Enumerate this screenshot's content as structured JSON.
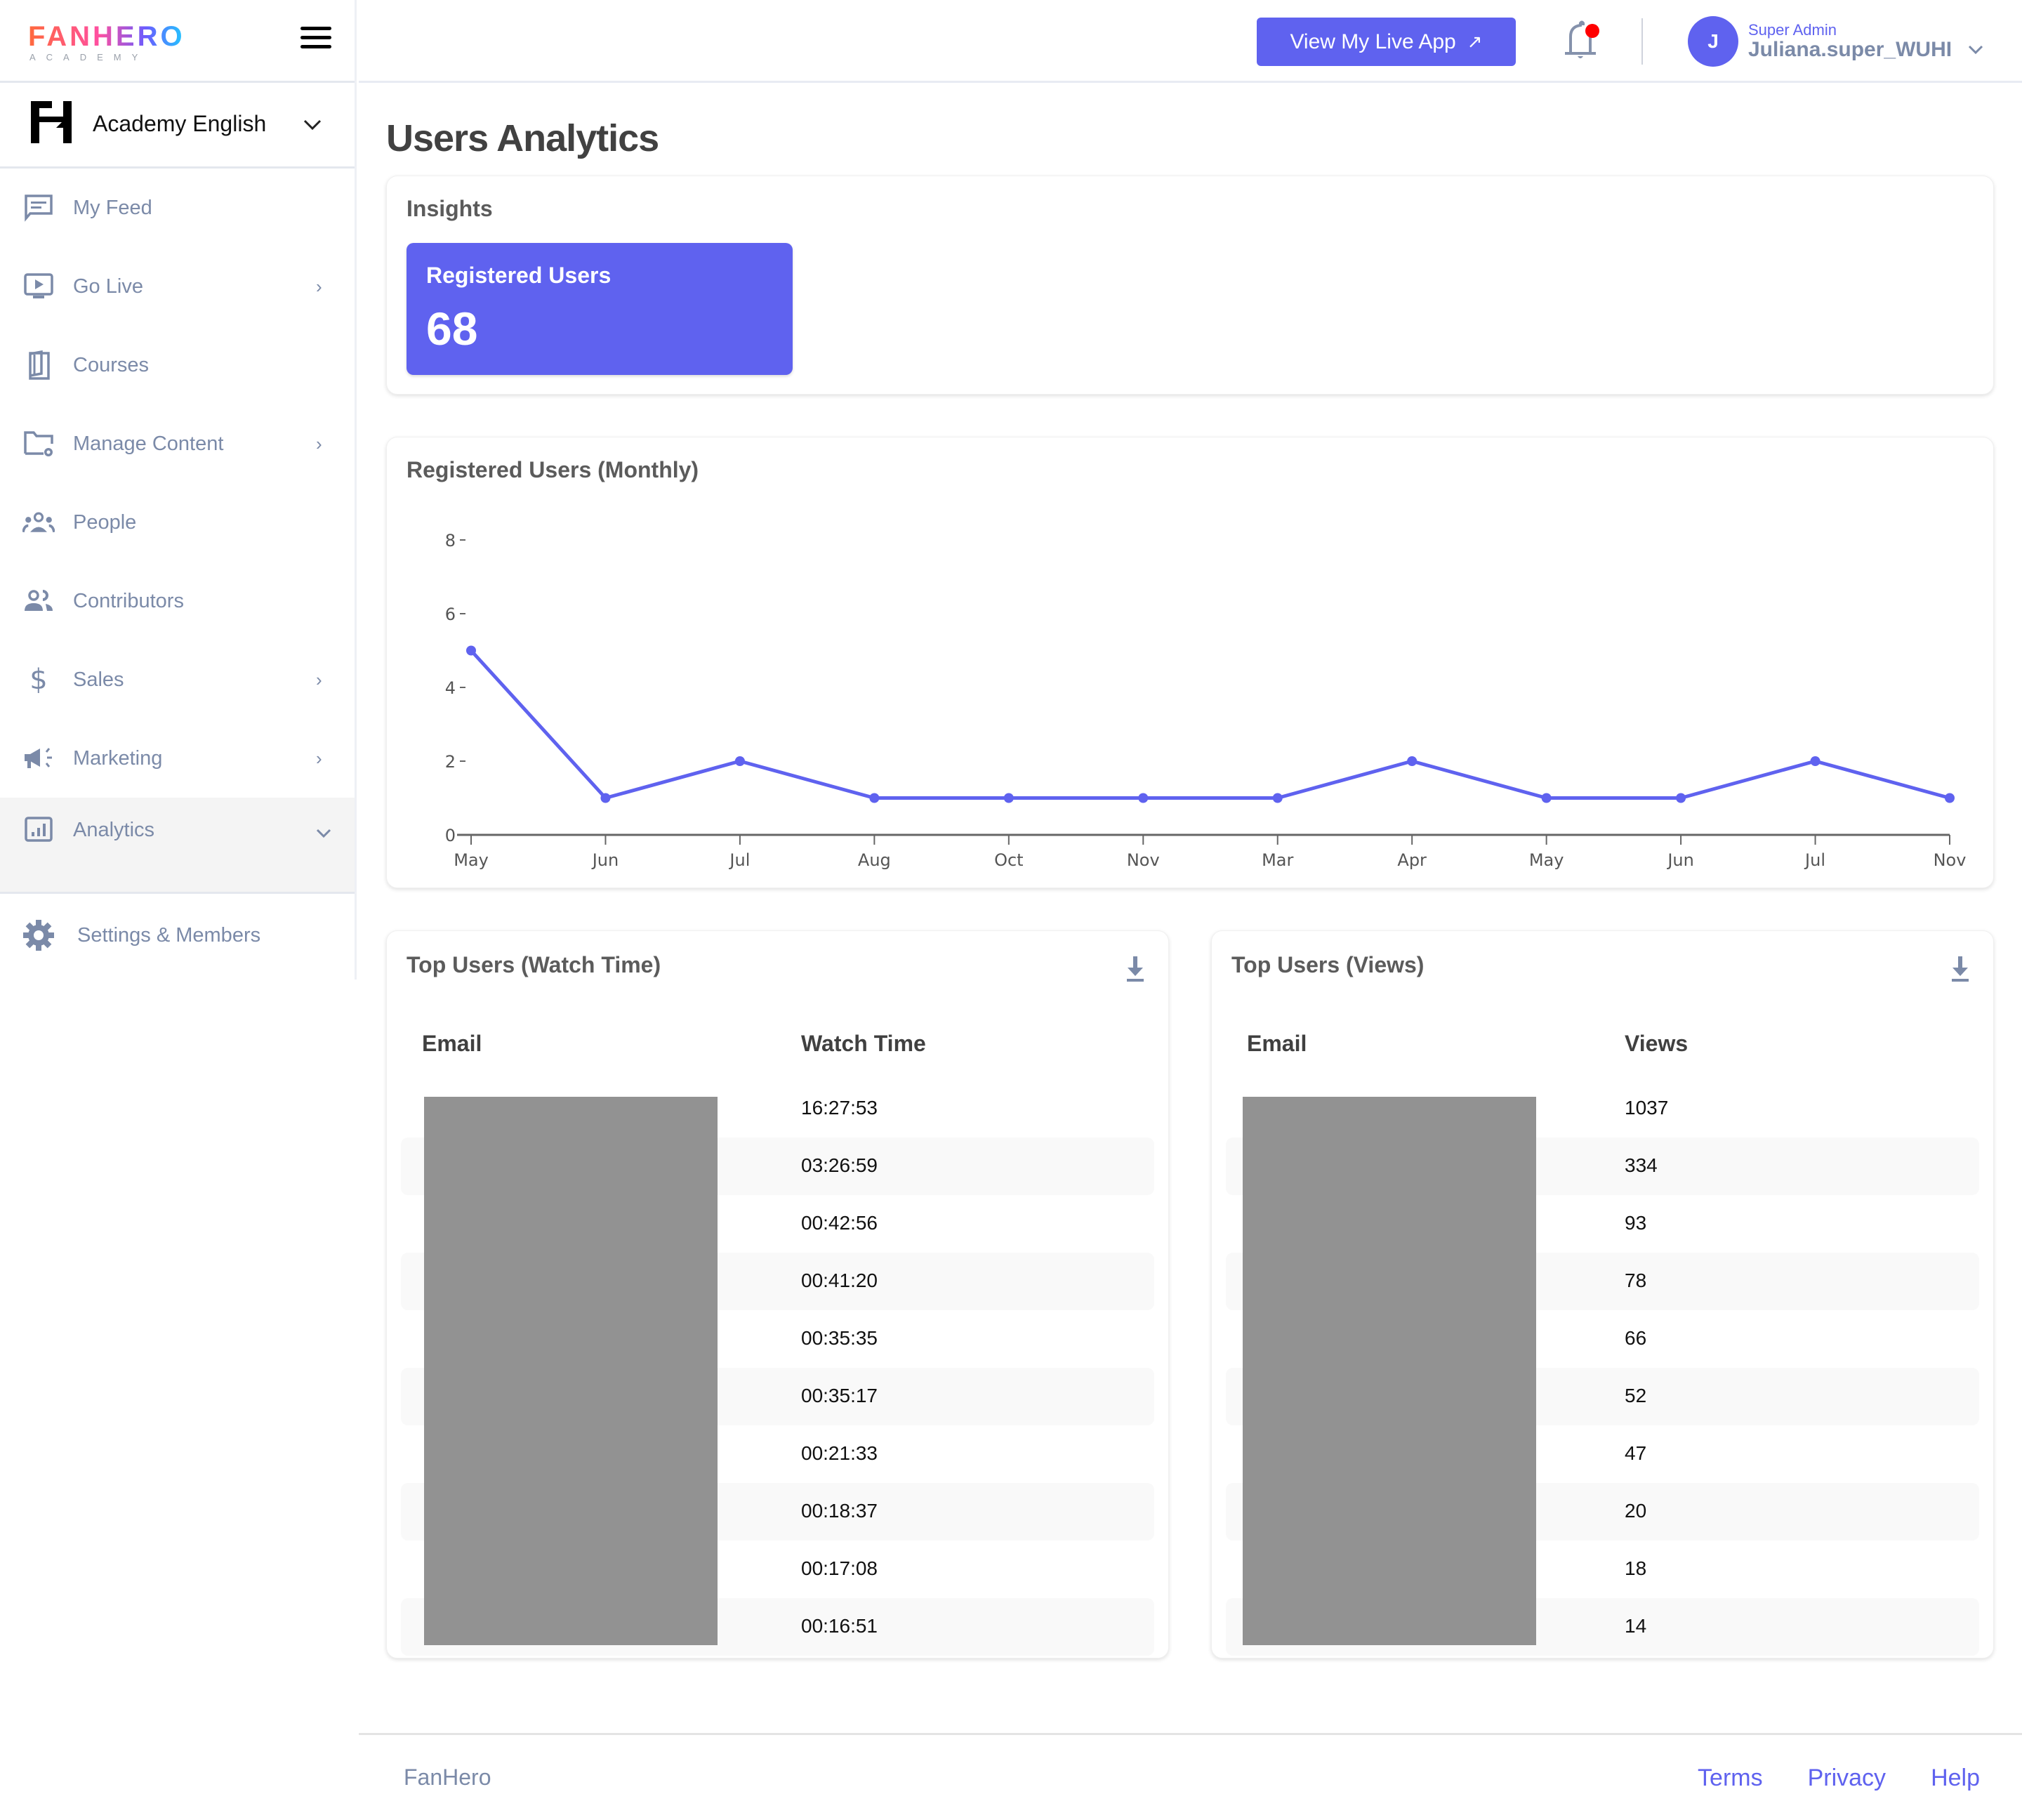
{
  "brand": {
    "logo_word": "FANHERO",
    "logo_sub": "ACADEMY",
    "org_name": "Academy English"
  },
  "sidebar": {
    "items": [
      {
        "label": "My Feed",
        "icon": "feed-icon",
        "has_arrow": false
      },
      {
        "label": "Go Live",
        "icon": "live-tv-icon",
        "has_arrow": true
      },
      {
        "label": "Courses",
        "icon": "book-icon",
        "has_arrow": false
      },
      {
        "label": "Manage Content",
        "icon": "folder-gear-icon",
        "has_arrow": true
      },
      {
        "label": "People",
        "icon": "people-icon",
        "has_arrow": false
      },
      {
        "label": "Contributors",
        "icon": "contributors-icon",
        "has_arrow": false
      },
      {
        "label": "Sales",
        "icon": "dollar-icon",
        "has_arrow": true
      },
      {
        "label": "Marketing",
        "icon": "megaphone-icon",
        "has_arrow": true
      },
      {
        "label": "Analytics",
        "icon": "analytics-icon",
        "expanded": true
      }
    ],
    "settings_label": "Settings & Members",
    "arrow_right": "›",
    "arrow_down": "⌄"
  },
  "header": {
    "live_button_label": "View My Live App",
    "live_button_icon": "↗",
    "notification_unread": true,
    "avatar_initial": "J",
    "user_role": "Super Admin",
    "user_name": "Juliana.super_WUHI",
    "user_chevron": "⌄"
  },
  "page": {
    "title": "Users Analytics",
    "insights_title": "Insights",
    "stat_label": "Registered Users",
    "stat_value": "68"
  },
  "colors": {
    "accent": "#5f62ef",
    "nav_text": "#7b8aa8",
    "notification_dot": "#ff0000",
    "redaction": "#929292"
  },
  "chart_data": {
    "type": "line",
    "title": "Registered Users (Monthly)",
    "xlabel": "",
    "ylabel": "",
    "categories": [
      "May",
      "Jun",
      "Jul",
      "Aug",
      "Oct",
      "Nov",
      "Mar",
      "Apr",
      "May",
      "Jun",
      "Jul",
      "Nov"
    ],
    "values": [
      5,
      1,
      2,
      1,
      1,
      1,
      1,
      2,
      1,
      1,
      2,
      1
    ],
    "ylim": [
      0,
      8
    ],
    "yticks": [
      0,
      2,
      4,
      6,
      8
    ],
    "grid": false,
    "legend": "none",
    "color": "#5f62ef"
  },
  "watch_table": {
    "title": "Top Users (Watch Time)",
    "columns": [
      "Email",
      "Watch Time"
    ],
    "rows": [
      "16:27:53",
      "03:26:59",
      "00:42:56",
      "00:41:20",
      "00:35:35",
      "00:35:17",
      "00:21:33",
      "00:18:37",
      "00:17:08",
      "00:16:51"
    ]
  },
  "views_table": {
    "title": "Top Users (Views)",
    "columns": [
      "Email",
      "Views"
    ],
    "rows": [
      "1037",
      "334",
      "93",
      "78",
      "66",
      "52",
      "47",
      "20",
      "18",
      "14"
    ]
  },
  "footer": {
    "brand": "FanHero",
    "links": [
      "Terms",
      "Privacy",
      "Help"
    ]
  }
}
